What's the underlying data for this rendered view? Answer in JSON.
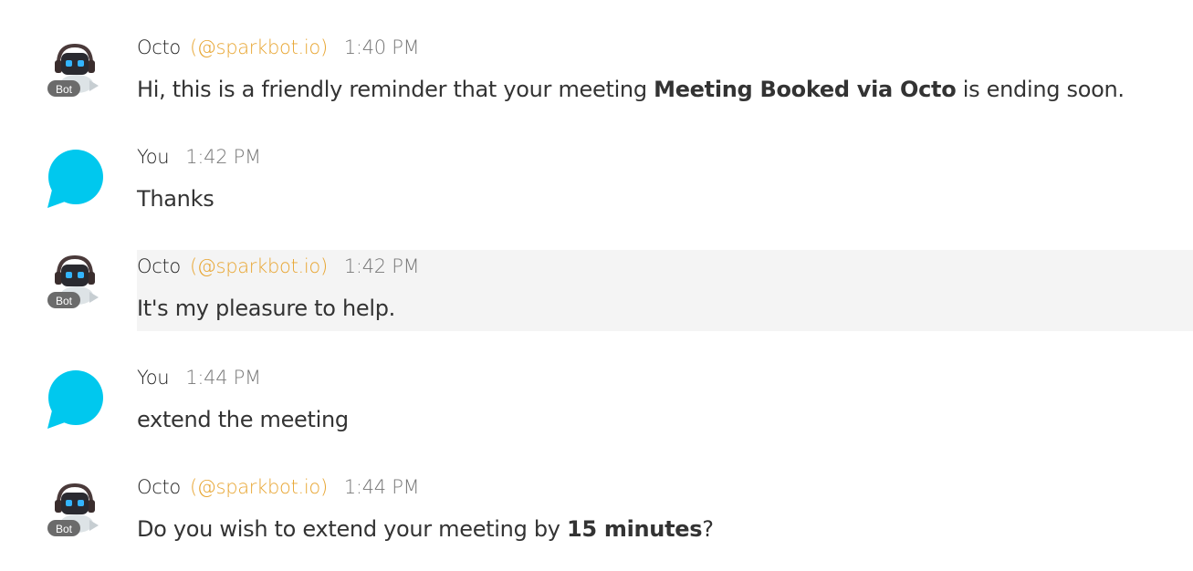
{
  "colors": {
    "handle": "#e8a633",
    "user_avatar": "#00c8ee",
    "highlight_bg": "#f4f4f4"
  },
  "messages": [
    {
      "sender": "Octo",
      "handle": "(@sparkbot.io)",
      "time": "1:40 PM",
      "avatar": "bot-avatar-icon",
      "badge": "Bot",
      "parts": [
        {
          "text": "Hi, this is a friendly reminder that your meeting ",
          "bold": false
        },
        {
          "text": "Meeting Booked via Octo",
          "bold": true
        },
        {
          "text": " is ending soon.",
          "bold": false
        }
      ]
    },
    {
      "sender": "You",
      "time": "1:42 PM",
      "avatar": "chat-bubble-icon",
      "parts": [
        {
          "text": "Thanks",
          "bold": false
        }
      ]
    },
    {
      "sender": "Octo",
      "handle": "(@sparkbot.io)",
      "time": "1:42 PM",
      "avatar": "bot-avatar-icon",
      "badge": "Bot",
      "highlighted": true,
      "parts": [
        {
          "text": "It's my pleasure to help.",
          "bold": false
        }
      ]
    },
    {
      "sender": "You",
      "time": "1:44 PM",
      "avatar": "chat-bubble-icon",
      "parts": [
        {
          "text": "extend the meeting",
          "bold": false
        }
      ]
    },
    {
      "sender": "Octo",
      "handle": "(@sparkbot.io)",
      "time": "1:44 PM",
      "avatar": "bot-avatar-icon",
      "badge": "Bot",
      "parts": [
        {
          "text": "Do you wish to extend your meeting by ",
          "bold": false
        },
        {
          "text": "15 minutes",
          "bold": true
        },
        {
          "text": "?",
          "bold": false
        }
      ]
    }
  ]
}
